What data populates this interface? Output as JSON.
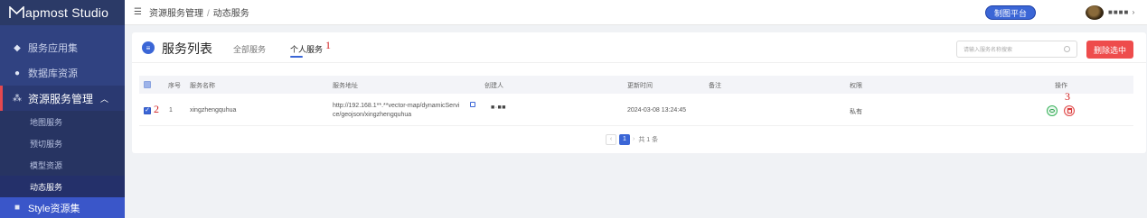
{
  "app": {
    "title": "apmost Studio"
  },
  "sidebar": {
    "items": [
      {
        "label": "服务应用集",
        "icon": "layers-icon"
      },
      {
        "label": "数据库资源",
        "icon": "database-icon"
      },
      {
        "label": "资源服务管理",
        "icon": "share-icon",
        "expanded": true
      },
      {
        "label": "Style资源集",
        "icon": "style-icon"
      }
    ],
    "sub_items": [
      {
        "label": "地图服务"
      },
      {
        "label": "预切服务"
      },
      {
        "label": "模型资源"
      },
      {
        "label": "动态服务",
        "current": true
      }
    ]
  },
  "topbar": {
    "breadcrumb": [
      "资源服务管理",
      "动态服务"
    ],
    "breadcrumb_sep": "/",
    "platform_button": "制图平台",
    "user_name": "■■■■",
    "user_chevron": "›"
  },
  "panel": {
    "title": "服务列表",
    "tabs": [
      {
        "label": "全部服务",
        "active": false
      },
      {
        "label": "个人服务",
        "active": true
      }
    ],
    "search_placeholder": "请输入服务名称搜索",
    "delete_button": "删除选中"
  },
  "annotations": [
    "1",
    "2",
    "3"
  ],
  "table": {
    "headers": [
      "序号",
      "服务名称",
      "服务地址",
      "创建人",
      "更新时间",
      "备注",
      "权限",
      "操作"
    ],
    "rows": [
      {
        "index": "1",
        "name": "xingzhengquhua",
        "address_line1": "http://192.168.1**.**vector-map/dynamicServi",
        "address_line2": "ce/geojson/xingzhengquhua",
        "creator": "■·■■",
        "updated": "2024-03-08 13:24:45",
        "remark": "",
        "permission": "私有"
      }
    ]
  },
  "pagination": {
    "prev": "‹",
    "current": "1",
    "next": "›",
    "total": "共 1 条"
  },
  "colors": {
    "sidebar": "#2b3a67",
    "accent": "#3b66d6",
    "danger": "#ee4c4c",
    "active_marker": "#e4484f"
  }
}
